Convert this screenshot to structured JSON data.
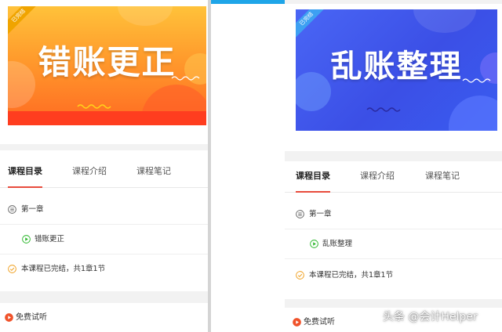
{
  "left": {
    "banner": {
      "title": "错账更正",
      "ribbon": "已完结"
    },
    "tabs": [
      "课程目录",
      "课程介绍",
      "课程笔记"
    ],
    "chapter": "第一章",
    "lesson": "错账更正",
    "status": "本课程已完结，共1章1节",
    "trial": "免费试听"
  },
  "right": {
    "banner": {
      "title": "乱账整理",
      "ribbon": "已完结"
    },
    "tabs": [
      "课程目录",
      "课程介绍",
      "课程笔记"
    ],
    "chapter": "第一章",
    "lesson": "乱账整理",
    "status": "本课程已完结，共1章1节",
    "trial": "免费试听"
  },
  "watermark": "头条 @会计Helper",
  "colors": {
    "accent": "#e84b3c",
    "play": "#2eb82e",
    "check": "#f0a020",
    "topbar": "#1ea5e8"
  }
}
